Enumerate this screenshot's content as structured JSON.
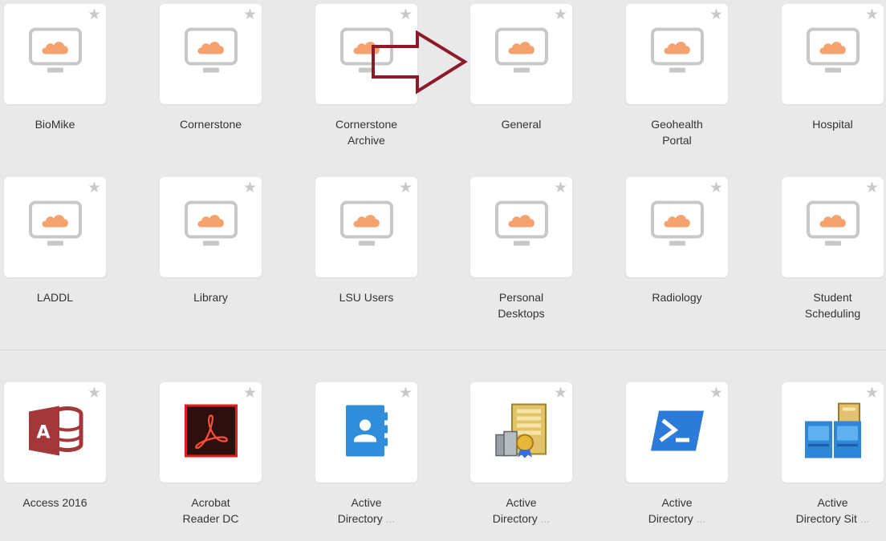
{
  "colors": {
    "background": "#e9e9e9",
    "tile": "#ffffff",
    "star": "#c9c9c9",
    "monitor_frame": "#c8c8c8",
    "cloud": "#f6a26f",
    "annotation_arrow": "#8b1a2b"
  },
  "desktops": [
    {
      "label": "BioMike",
      "icon": "cloud-desktop-icon"
    },
    {
      "label": "Cornerstone",
      "icon": "cloud-desktop-icon"
    },
    {
      "label": "Cornerstone\nArchive",
      "icon": "cloud-desktop-icon"
    },
    {
      "label": "General",
      "icon": "cloud-desktop-icon"
    },
    {
      "label": "Geohealth\nPortal",
      "icon": "cloud-desktop-icon"
    },
    {
      "label": "Hospital",
      "icon": "cloud-desktop-icon"
    },
    {
      "label": "LADDL",
      "icon": "cloud-desktop-icon"
    },
    {
      "label": "Library",
      "icon": "cloud-desktop-icon"
    },
    {
      "label": "LSU Users",
      "icon": "cloud-desktop-icon"
    },
    {
      "label": "Personal\nDesktops",
      "icon": "cloud-desktop-icon"
    },
    {
      "label": "Radiology",
      "icon": "cloud-desktop-icon"
    },
    {
      "label": "Student\nScheduling",
      "icon": "cloud-desktop-icon"
    }
  ],
  "apps": [
    {
      "label": "Access 2016",
      "icon": "access-icon"
    },
    {
      "label": "Acrobat\nReader DC",
      "icon": "acrobat-icon"
    },
    {
      "label": "Active\nDirectory ",
      "suffix": "...",
      "icon": "address-book-icon"
    },
    {
      "label": "Active\nDirectory ",
      "suffix": "...",
      "icon": "certificate-server-icon"
    },
    {
      "label": "Active\nDirectory ",
      "suffix": "...",
      "icon": "powershell-icon"
    },
    {
      "label": "Active\nDirectory Sit",
      "suffix": "...",
      "icon": "sites-services-icon"
    }
  ],
  "star_glyph": "★"
}
